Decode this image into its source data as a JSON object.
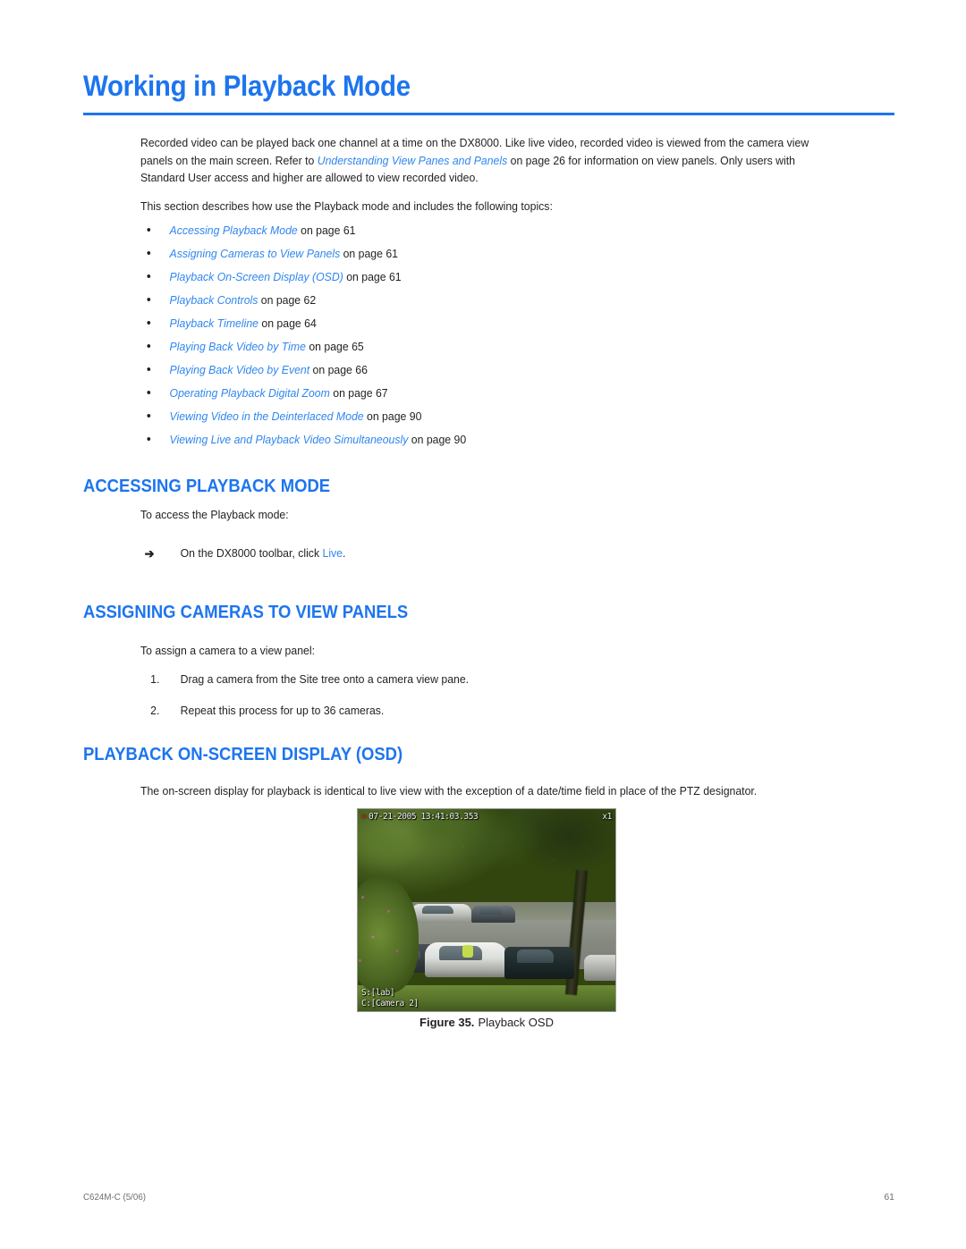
{
  "document": {
    "title": "Working in Playback Mode",
    "accent_color": "#1d75ee",
    "link_color": "#2f86ef",
    "text_color": "#231f20"
  },
  "intro": {
    "paragraph1_part1": "Recorded video can be played back one channel at a time on the DX8000. Like live video, recorded video is viewed from the camera view panels on the main screen. Refer to ",
    "paragraph1_link": "Understanding View Panes and Panels",
    "paragraph1_part2": " on page 26 for information on view panels. Only users with Standard User access and higher are allowed to view recorded video.",
    "paragraph2": "This section describes how use the Playback mode and includes the following topics:"
  },
  "topics": [
    {
      "bullet": "•",
      "link": "Accessing Playback Mode",
      "suffix": " on page 61"
    },
    {
      "bullet": "•",
      "link": "Assigning Cameras to View Panels",
      "suffix": " on page 61"
    },
    {
      "bullet": "•",
      "link": "Playback On-Screen Display (OSD)",
      "suffix": " on page 61"
    },
    {
      "bullet": "•",
      "link": "Playback Controls",
      "suffix": " on page 62"
    },
    {
      "bullet": "•",
      "link": "Playback Timeline",
      "suffix": " on page 64"
    },
    {
      "bullet": "•",
      "link": "Playing Back Video by Time",
      "suffix": " on page 65"
    },
    {
      "bullet": "•",
      "link": "Playing Back Video by Event",
      "suffix": " on page 66"
    },
    {
      "bullet": "•",
      "link": "Operating Playback Digital Zoom",
      "suffix": " on page 67"
    },
    {
      "bullet": "•",
      "link": "Viewing Video in the Deinterlaced Mode",
      "suffix": " on page 90"
    },
    {
      "bullet": "•",
      "link": "Viewing Live and Playback Video Simultaneously",
      "suffix": " on page 90"
    }
  ],
  "section_accessing": {
    "heading": "ACCESSING PLAYBACK MODE",
    "lead": "To access the Playback mode:",
    "step_marker": "➔",
    "step_text_part1": "On the DX8000 toolbar, click ",
    "step_link": "Live",
    "step_text_part2": "."
  },
  "section_assigning": {
    "heading": "ASSIGNING CAMERAS TO VIEW PANELS",
    "lead": "To assign a camera to a view panel:",
    "steps": [
      {
        "marker": "1.",
        "text": "Drag a camera from the Site tree onto a camera view pane."
      },
      {
        "marker": "2.",
        "text": "Repeat this process for up to 36 cameras."
      }
    ]
  },
  "section_osd": {
    "heading": "PLAYBACK ON-SCREEN DISPLAY (OSD)",
    "lead": "The on-screen display for playback is identical to live view with the exception of a date/time field in place of the PTZ designator."
  },
  "figure": {
    "caption_label": "Figure 35.",
    "caption_text": "Playback OSD",
    "osd": {
      "play_icon": "»",
      "timestamp": "07-21-2005 13:41:03.353",
      "speed": "x1",
      "site_label": "S:[lab]",
      "camera_label": "C:[Camera 2]"
    }
  },
  "footer": {
    "left": "C624M-C (5/06)",
    "page_number": "61"
  }
}
